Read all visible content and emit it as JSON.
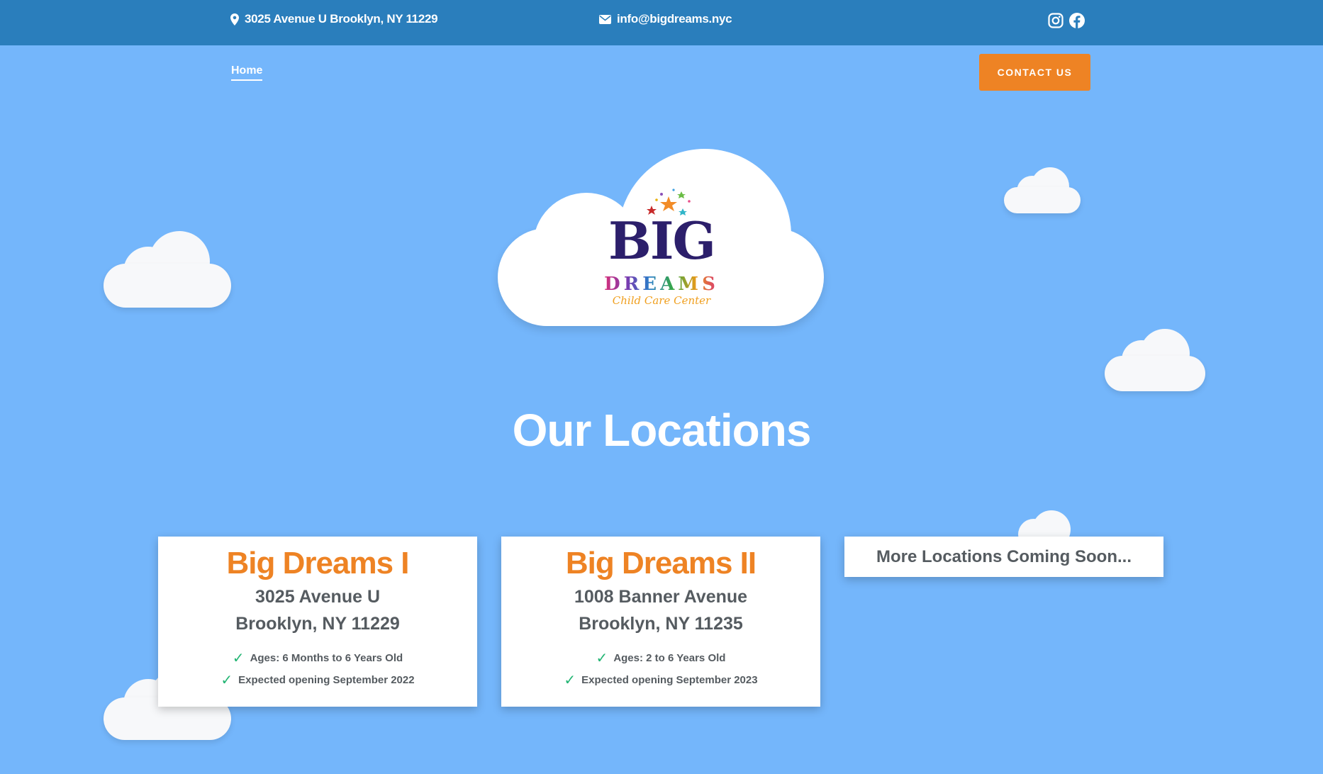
{
  "topbar": {
    "address": "3025 Avenue U Brooklyn, NY 11229",
    "email": "info@bigdreams.nyc",
    "address_icon": "map-pin-icon",
    "email_icon": "envelope-icon",
    "social": [
      "instagram-icon",
      "facebook-icon"
    ]
  },
  "nav": {
    "home": "Home",
    "contact": "CONTACT US"
  },
  "logo": {
    "big": "BIG",
    "dreams": "DREAMS",
    "subtitle": "Child Care Center"
  },
  "heading": "Our Locations",
  "locations": [
    {
      "title": "Big Dreams I",
      "address_line1": "3025 Avenue U",
      "address_line2": "Brooklyn, NY 11229",
      "ages": "Ages: 6 Months to 6 Years Old",
      "opening": "Expected opening September 2022"
    },
    {
      "title": "Big Dreams II",
      "address_line1": "1008 Banner Avenue",
      "address_line2": "Brooklyn, NY 11235",
      "ages": "Ages: 2 to 6 Years Old",
      "opening": "Expected opening September 2023"
    }
  ],
  "coming_soon": "More Locations Coming Soon...",
  "colors": {
    "background": "#74b6fb",
    "topbar": "#2a7ebc",
    "accent": "#ee8324",
    "check": "#22b573",
    "text": "#555b60"
  }
}
